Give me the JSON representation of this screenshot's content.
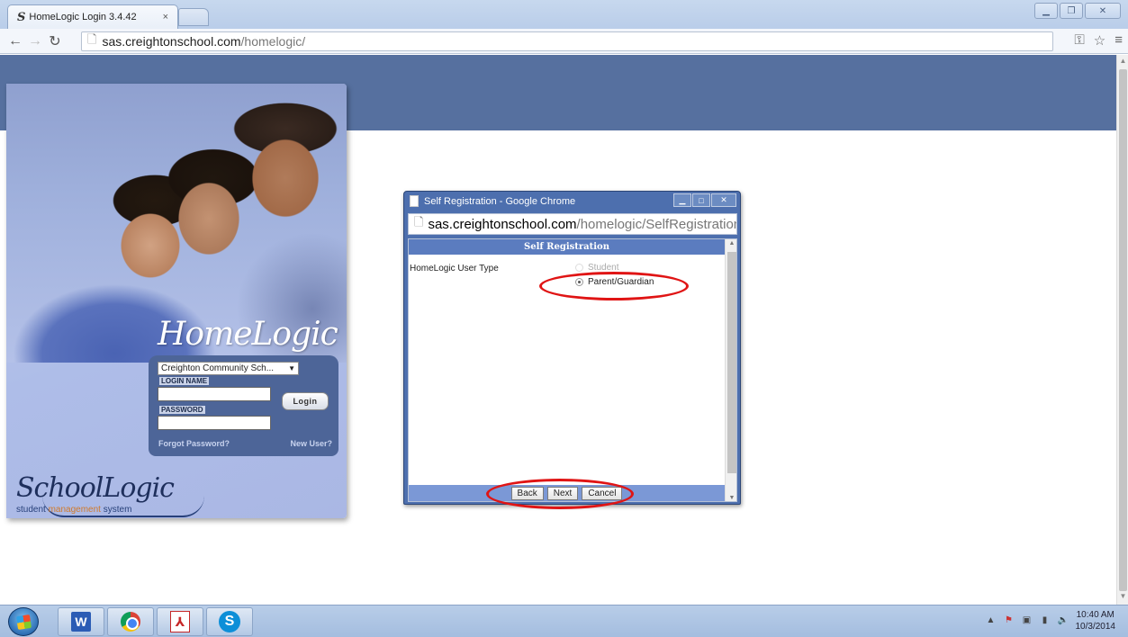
{
  "browser": {
    "tab_title": "HomeLogic Login 3.4.42",
    "tab_favicon": "S",
    "tab_close": "×",
    "url_host": "sas.creightonschool.com",
    "url_path": "/homelogic/"
  },
  "login": {
    "brand": "HomeLogic",
    "district": "Creighton Community Sch...",
    "login_name_label": "LOGIN NAME",
    "password_label": "PASSWORD",
    "login_button": "Login",
    "forgot_password": "Forgot Password?",
    "new_user": "New User?",
    "footer_logo": "SchoolLogic",
    "footer_tag_1": "student ",
    "footer_tag_2": "management",
    "footer_tag_3": " system"
  },
  "popup": {
    "title": "Self Registration - Google Chrome",
    "url_host": "sas.creightonschool.com",
    "url_path": "/homelogic/SelfRegistration/",
    "header": "Self Registration",
    "field_label": "HomeLogic User Type",
    "options": [
      {
        "label": "Student",
        "checked": false
      },
      {
        "label": "Parent/Guardian",
        "checked": true
      }
    ],
    "buttons": {
      "back": "Back",
      "next": "Next",
      "cancel": "Cancel"
    }
  },
  "taskbar": {
    "clock_time": "10:40 AM",
    "clock_date": "10/3/2014"
  },
  "colors": {
    "banner": "#56709f",
    "highlight": "#e01414",
    "popup_header": "#5b7cbf"
  }
}
